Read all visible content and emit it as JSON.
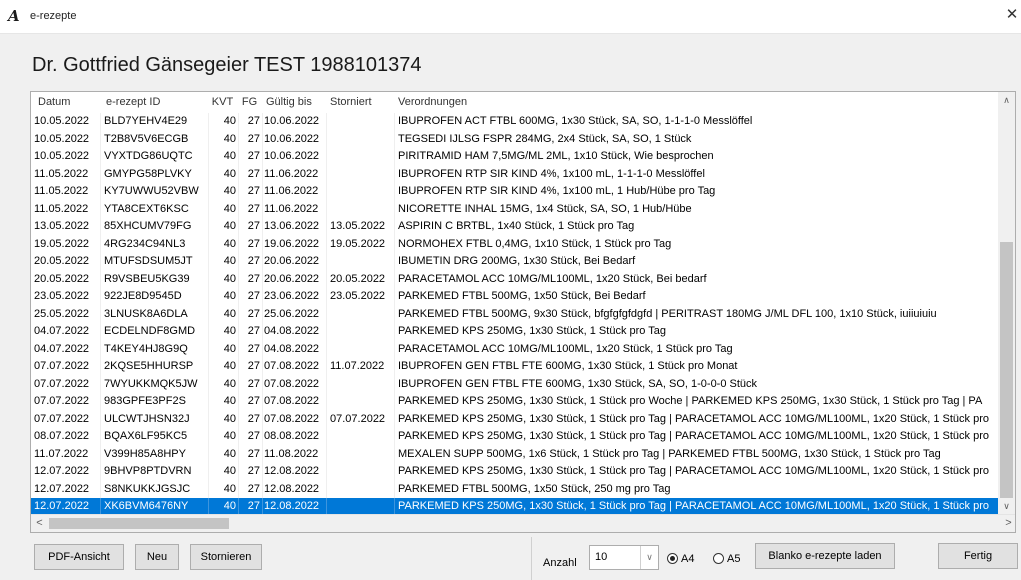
{
  "window": {
    "title": "e-rezepte",
    "close_symbol": "✕",
    "app_icon_glyph": "A"
  },
  "doctor_title": "Dr. Gottfried Gänsegeier TEST 1988101374",
  "table": {
    "columns": [
      "Datum",
      "e-rezept ID",
      "KVT",
      "FG",
      "Gültig bis",
      "Storniert",
      "Verordnungen"
    ],
    "selected_index": 22,
    "rows": [
      {
        "date": "10.05.2022",
        "id": "BLD7YEHV4E29",
        "kvt": "40",
        "fg": "27",
        "valid": "10.06.2022",
        "storno": "",
        "verord": "IBUPROFEN ACT FTBL 600MG, 1x30 Stück, SA, SO, 1-1-1-0 Messlöffel"
      },
      {
        "date": "10.05.2022",
        "id": "T2B8V5V6ECGB",
        "kvt": "40",
        "fg": "27",
        "valid": "10.06.2022",
        "storno": "",
        "verord": "TEGSEDI IJLSG FSPR 284MG, 2x4 Stück, SA, SO, 1 Stück"
      },
      {
        "date": "10.05.2022",
        "id": "VYXTDG86UQTC",
        "kvt": "40",
        "fg": "27",
        "valid": "10.06.2022",
        "storno": "",
        "verord": "PIRITRAMID HAM 7,5MG/ML 2ML, 1x10 Stück, Wie besprochen"
      },
      {
        "date": "11.05.2022",
        "id": "GMYPG58PLVKY",
        "kvt": "40",
        "fg": "27",
        "valid": "11.06.2022",
        "storno": "",
        "verord": "IBUPROFEN RTP SIR KIND 4%, 1x100 mL, 1-1-1-0 Messlöffel"
      },
      {
        "date": "11.05.2022",
        "id": "KY7UWWU52VBW",
        "kvt": "40",
        "fg": "27",
        "valid": "11.06.2022",
        "storno": "",
        "verord": "IBUPROFEN RTP SIR KIND 4%, 1x100 mL, 1 Hub/Hübe pro Tag"
      },
      {
        "date": "11.05.2022",
        "id": "YTA8CEXT6KSC",
        "kvt": "40",
        "fg": "27",
        "valid": "11.06.2022",
        "storno": "",
        "verord": "NICORETTE INHAL 15MG, 1x4 Stück, SA, SO, 1 Hub/Hübe"
      },
      {
        "date": "13.05.2022",
        "id": "85XHCUMV79FG",
        "kvt": "40",
        "fg": "27",
        "valid": "13.06.2022",
        "storno": "13.05.2022",
        "verord": "ASPIRIN C BRTBL, 1x40 Stück, 1 Stück pro Tag"
      },
      {
        "date": "19.05.2022",
        "id": "4RG234C94NL3",
        "kvt": "40",
        "fg": "27",
        "valid": "19.06.2022",
        "storno": "19.05.2022",
        "verord": "NORMOHEX FTBL 0,4MG, 1x10 Stück, 1 Stück pro Tag"
      },
      {
        "date": "20.05.2022",
        "id": "MTUFSDSUM5JT",
        "kvt": "40",
        "fg": "27",
        "valid": "20.06.2022",
        "storno": "",
        "verord": "IBUMETIN DRG 200MG, 1x30 Stück, Bei Bedarf"
      },
      {
        "date": "20.05.2022",
        "id": "R9VSBEU5KG39",
        "kvt": "40",
        "fg": "27",
        "valid": "20.06.2022",
        "storno": "20.05.2022",
        "verord": "PARACETAMOL ACC 10MG/ML100ML, 1x20 Stück, Bei bedarf"
      },
      {
        "date": "23.05.2022",
        "id": "922JE8D9545D",
        "kvt": "40",
        "fg": "27",
        "valid": "23.06.2022",
        "storno": "23.05.2022",
        "verord": "PARKEMED FTBL 500MG, 1x50 Stück, Bei Bedarf"
      },
      {
        "date": "25.05.2022",
        "id": "3LNUSK8A6DLA",
        "kvt": "40",
        "fg": "27",
        "valid": "25.06.2022",
        "storno": "",
        "verord": "PARKEMED FTBL 500MG, 9x30 Stück, bfgfgfgfdgfd   |   PERITRAST 180MG J/ML DFL 100, 1x10 Stück, iuiiuiuiu"
      },
      {
        "date": "04.07.2022",
        "id": "ECDELNDF8GMD",
        "kvt": "40",
        "fg": "27",
        "valid": "04.08.2022",
        "storno": "",
        "verord": "PARKEMED KPS 250MG, 1x30 Stück, 1 Stück pro Tag"
      },
      {
        "date": "04.07.2022",
        "id": "T4KEY4HJ8G9Q",
        "kvt": "40",
        "fg": "27",
        "valid": "04.08.2022",
        "storno": "",
        "verord": "PARACETAMOL ACC 10MG/ML100ML, 1x20 Stück, 1 Stück pro Tag"
      },
      {
        "date": "07.07.2022",
        "id": "2KQSE5HHURSP",
        "kvt": "40",
        "fg": "27",
        "valid": "07.08.2022",
        "storno": "11.07.2022",
        "verord": "IBUPROFEN GEN FTBL FTE 600MG, 1x30 Stück, 1 Stück pro Monat"
      },
      {
        "date": "07.07.2022",
        "id": "7WYUKKMQK5JW",
        "kvt": "40",
        "fg": "27",
        "valid": "07.08.2022",
        "storno": "",
        "verord": "IBUPROFEN GEN FTBL FTE 600MG, 1x30 Stück, SA, SO, 1-0-0-0 Stück"
      },
      {
        "date": "07.07.2022",
        "id": "983GPFE3PF2S",
        "kvt": "40",
        "fg": "27",
        "valid": "07.08.2022",
        "storno": "",
        "verord": "PARKEMED KPS 250MG, 1x30 Stück, 1 Stück pro Woche   |   PARKEMED KPS 250MG, 1x30 Stück, 1 Stück pro Tag   |   PA"
      },
      {
        "date": "07.07.2022",
        "id": "ULCWTJHSN32J",
        "kvt": "40",
        "fg": "27",
        "valid": "07.08.2022",
        "storno": "07.07.2022",
        "verord": "PARKEMED KPS 250MG, 1x30 Stück, 1 Stück pro Tag   |   PARACETAMOL ACC 10MG/ML100ML, 1x20 Stück, 1 Stück pro"
      },
      {
        "date": "08.07.2022",
        "id": "BQAX6LF95KC5",
        "kvt": "40",
        "fg": "27",
        "valid": "08.08.2022",
        "storno": "",
        "verord": "PARKEMED KPS 250MG, 1x30 Stück, 1 Stück pro Tag   |   PARACETAMOL ACC 10MG/ML100ML, 1x20 Stück, 1 Stück pro"
      },
      {
        "date": "11.07.2022",
        "id": "V399H85A8HPY",
        "kvt": "40",
        "fg": "27",
        "valid": "11.08.2022",
        "storno": "",
        "verord": "MEXALEN SUPP 500MG, 1x6 Stück, 1 Stück pro Tag   |   PARKEMED FTBL 500MG, 1x30 Stück, 1 Stück pro Tag"
      },
      {
        "date": "12.07.2022",
        "id": "9BHVP8PTDVRN",
        "kvt": "40",
        "fg": "27",
        "valid": "12.08.2022",
        "storno": "",
        "verord": "PARKEMED KPS 250MG, 1x30 Stück, 1 Stück pro Tag   |   PARACETAMOL ACC 10MG/ML100ML, 1x20 Stück, 1 Stück pro"
      },
      {
        "date": "12.07.2022",
        "id": "S8NKUKKJGSJC",
        "kvt": "40",
        "fg": "27",
        "valid": "12.08.2022",
        "storno": "",
        "verord": "PARKEMED FTBL 500MG, 1x50 Stück, 250 mg pro Tag"
      },
      {
        "date": "12.07.2022",
        "id": "XK6BVM6476NY",
        "kvt": "40",
        "fg": "27",
        "valid": "12.08.2022",
        "storno": "",
        "verord": "PARKEMED KPS 250MG, 1x30 Stück, 1 Stück pro Tag   |   PARACETAMOL ACC 10MG/ML100ML, 1x20 Stück, 1 Stück pro"
      }
    ]
  },
  "scroll": {
    "up": "∧",
    "down": "∨",
    "left": "<",
    "right": ">"
  },
  "buttons": {
    "pdf": "PDF-Ansicht",
    "neu": "Neu",
    "stornieren": "Stornieren",
    "blanko": "Blanko e-rezepte laden",
    "fertig": "Fertig"
  },
  "anzahl": {
    "label": "Anzahl",
    "value": "10",
    "arrow": "∨"
  },
  "format": {
    "a4_label": "A4",
    "a5_label": "A5",
    "selected": "A4"
  },
  "colors": {
    "selection": "#0078d7",
    "window_bg": "#f0f0f0"
  }
}
